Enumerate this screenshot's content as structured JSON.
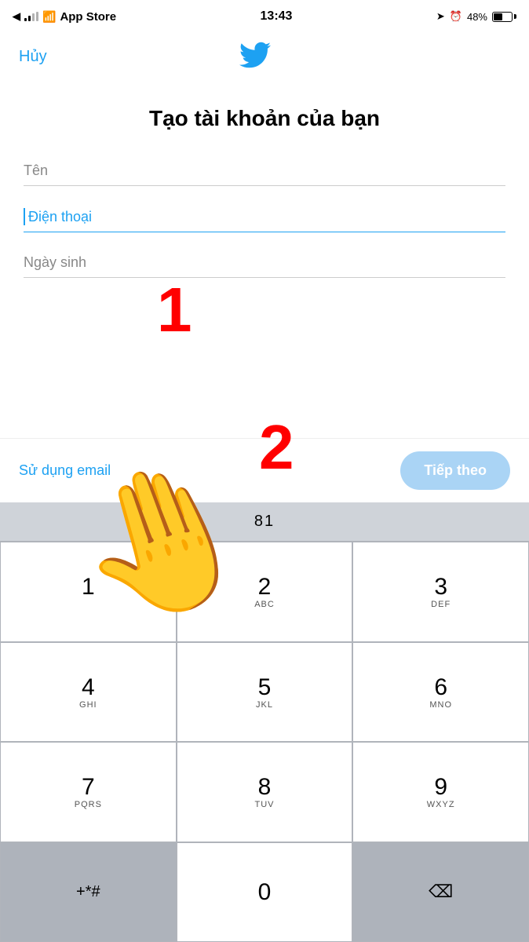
{
  "statusBar": {
    "carrier": "App Store",
    "time": "13:43",
    "battery": "48%"
  },
  "header": {
    "cancel": "Hủy",
    "logo": "🐦"
  },
  "form": {
    "title": "Tạo tài khoản của bạn",
    "fields": [
      {
        "label": "Tên",
        "active": false
      },
      {
        "label": "Điện thoại",
        "active": true
      },
      {
        "label": "Ngày sinh",
        "active": false
      }
    ]
  },
  "actionBar": {
    "useEmail": "Sử dụng email",
    "next": "Tiếp theo"
  },
  "keyboard": {
    "display": "81",
    "rows": [
      [
        {
          "num": "1",
          "letters": ""
        },
        {
          "num": "2",
          "letters": "ABC"
        },
        {
          "num": "3",
          "letters": "DEF"
        }
      ],
      [
        {
          "num": "4",
          "letters": "GHI"
        },
        {
          "num": "5",
          "letters": "JKL"
        },
        {
          "num": "6",
          "letters": "MNO"
        }
      ],
      [
        {
          "num": "7",
          "letters": "PQRS"
        },
        {
          "num": "8",
          "letters": "TUV"
        },
        {
          "num": "9",
          "letters": "WXYZ"
        }
      ]
    ],
    "bottomLeft": "+*#",
    "zero": "0",
    "delete": "⌫"
  },
  "annotations": {
    "step1": "1",
    "step2": "2"
  }
}
